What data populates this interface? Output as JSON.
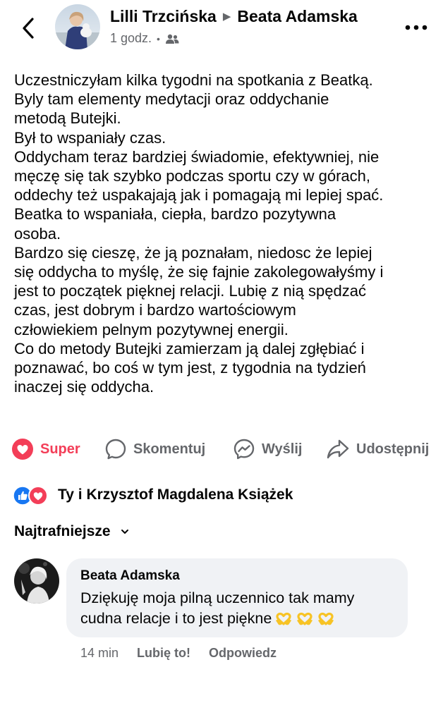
{
  "header": {
    "author": "Lilli Trzcińska",
    "separator_icon": "triangle-right-icon",
    "recipient": "Beata Adamska",
    "time": "1 godz.",
    "audience_icon": "friends-icon",
    "back_icon": "chevron-left-icon",
    "more_icon": "more-dots-icon"
  },
  "post": {
    "lines": [
      "Uczestniczyłam kilka tygodni na spotkania z Beatką.",
      "Byly tam elementy medytacji oraz oddychanie",
      "metodą Butejki.",
      "Był to wspaniały czas.",
      "Oddycham teraz bardziej świadomie, efektywniej, nie",
      "męczę się tak szybko podczas sportu czy w górach,",
      "oddechy też uspakajają jak i pomagają mi lepiej spać.",
      "Beatka to wspaniała,  ciepła, bardzo pozytywna",
      "osoba.",
      "Bardzo się cieszę,  że ją poznałam,  niedosc że lepiej",
      "się oddycha to myślę, że się fajnie zakolegowałyśmy i",
      "jest to początek pięknej relacji. Lubię z nią spędzać",
      "czas, jest dobrym i bardzo wartościowym",
      "człowiekiem pelnym pozytywnej energii.",
      "Co do metody Butejki zamierzam ją dalej zgłębiać i",
      "poznawać, bo coś w tym jest, z tygodnia na tydzień",
      "inaczej się oddycha."
    ]
  },
  "actions": {
    "super": "Super",
    "comment": "Skomentuj",
    "send": "Wyślij",
    "share": "Udostępnij"
  },
  "reactions": {
    "names": "Ty i Krzysztof Magdalena Książek",
    "icons": [
      "like-icon",
      "love-icon"
    ]
  },
  "sort": {
    "label": "Najtrafniejsze"
  },
  "comment": {
    "author": "Beata Adamska",
    "text_lines": [
      "Dziękuję moja pilną uczennico tak mamy",
      "cudna relacje i to jest piękne"
    ],
    "emoji_count": 3,
    "time": "14 min",
    "like": "Lubię to!",
    "reply": "Odpowiedz"
  },
  "colors": {
    "accent_love": "#f33e58",
    "like_blue": "#1877f2",
    "muted": "#65676b",
    "bubble": "#f0f2f5",
    "emoji_yellow": "#f7c325"
  }
}
